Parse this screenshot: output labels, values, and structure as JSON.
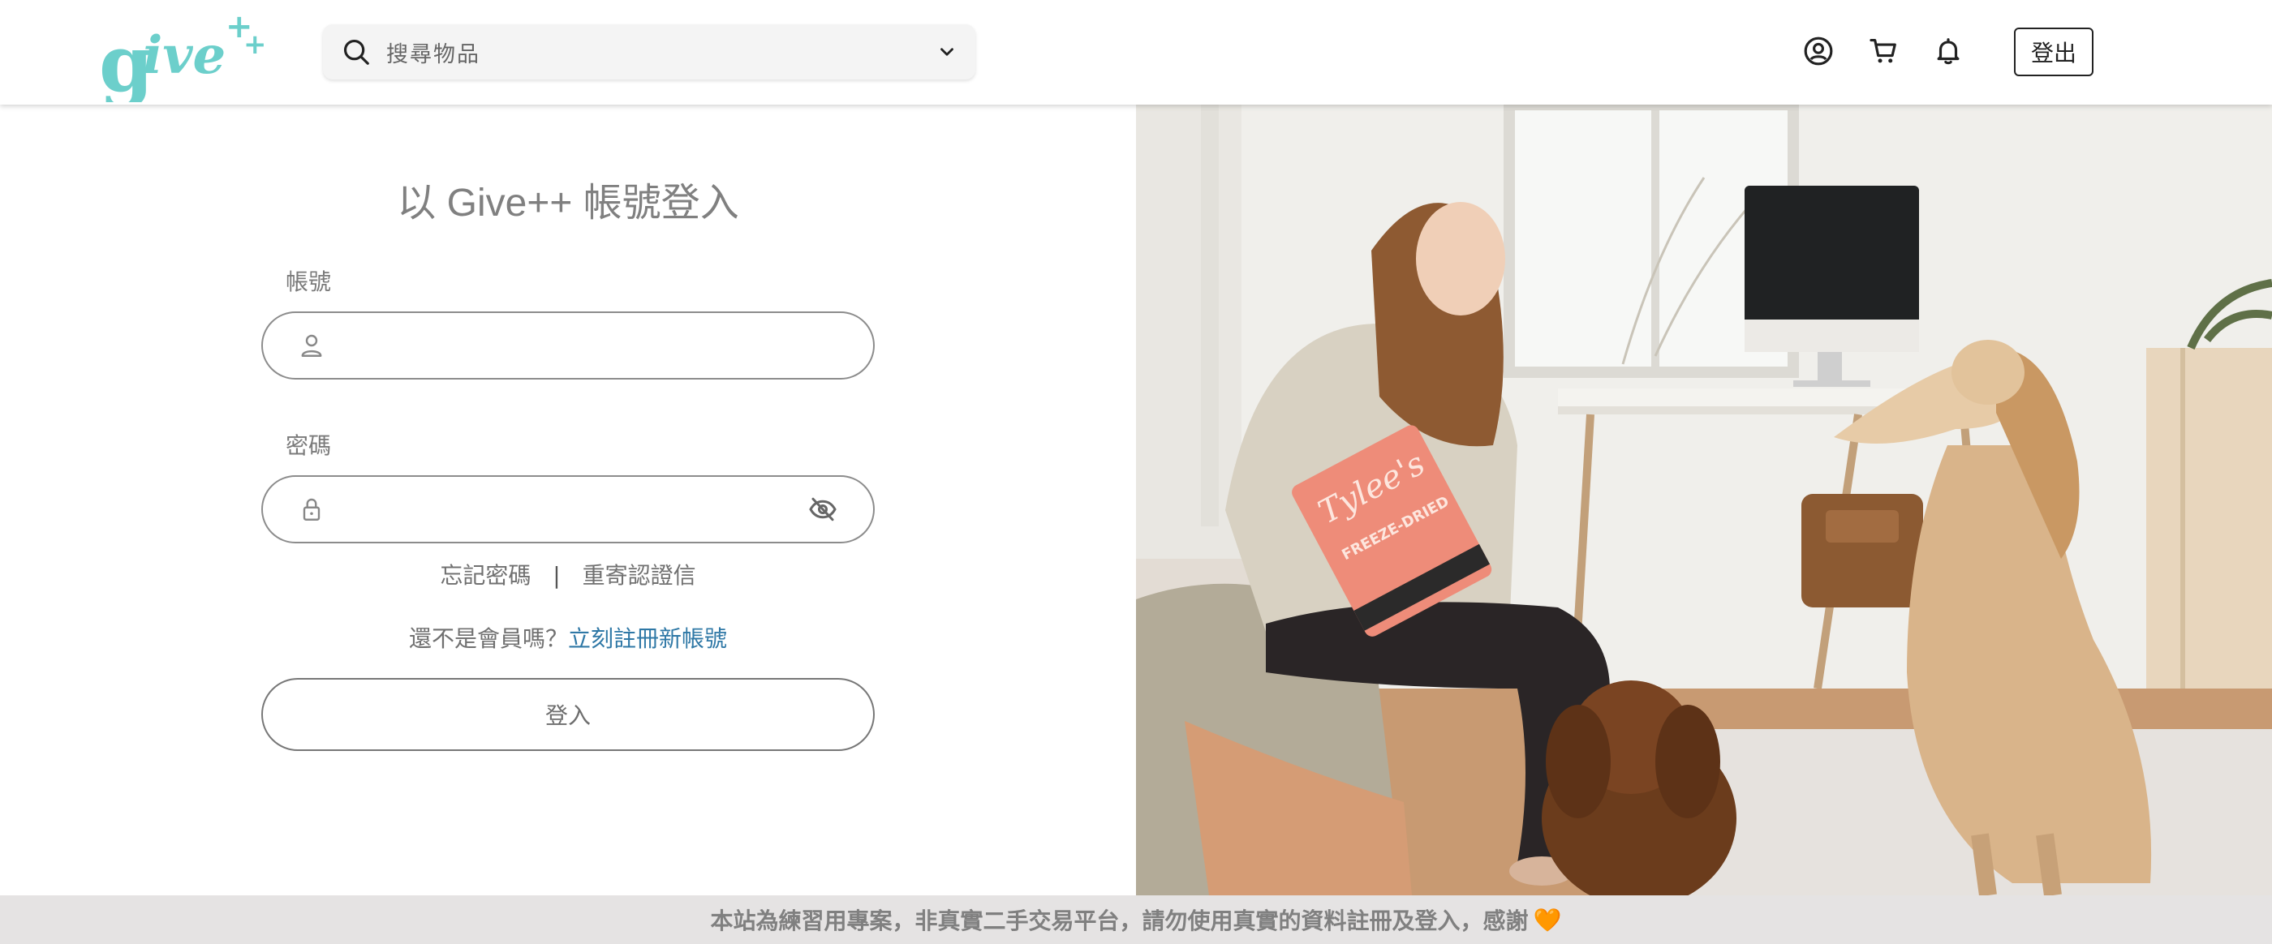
{
  "header": {
    "logo_text": "give++",
    "search_placeholder": "搜尋物品",
    "logout_label": "登出",
    "icons": [
      "search-icon",
      "chevron-down-icon",
      "user-circle-icon",
      "cart-icon",
      "bell-icon"
    ]
  },
  "login": {
    "title": "以 Give++ 帳號登入",
    "account_label": "帳號",
    "account_value": "",
    "password_label": "密碼",
    "password_value": "",
    "forgot_password": "忘記密碼",
    "separator": "|",
    "resend_verification": "重寄認證信",
    "not_member_prompt": "還不是會員嗎？",
    "register_link": "立刻註冊新帳號",
    "login_button": "登入"
  },
  "notice": {
    "text": "本站為練習用專案，非真實二手交易平台，請勿使用真實的資料註冊及登入，感謝",
    "heart": "🧡"
  },
  "colors": {
    "brand_teal": "#6ccfcb",
    "link_blue": "#2f78a6",
    "notice_bg": "#e5e3e3"
  }
}
